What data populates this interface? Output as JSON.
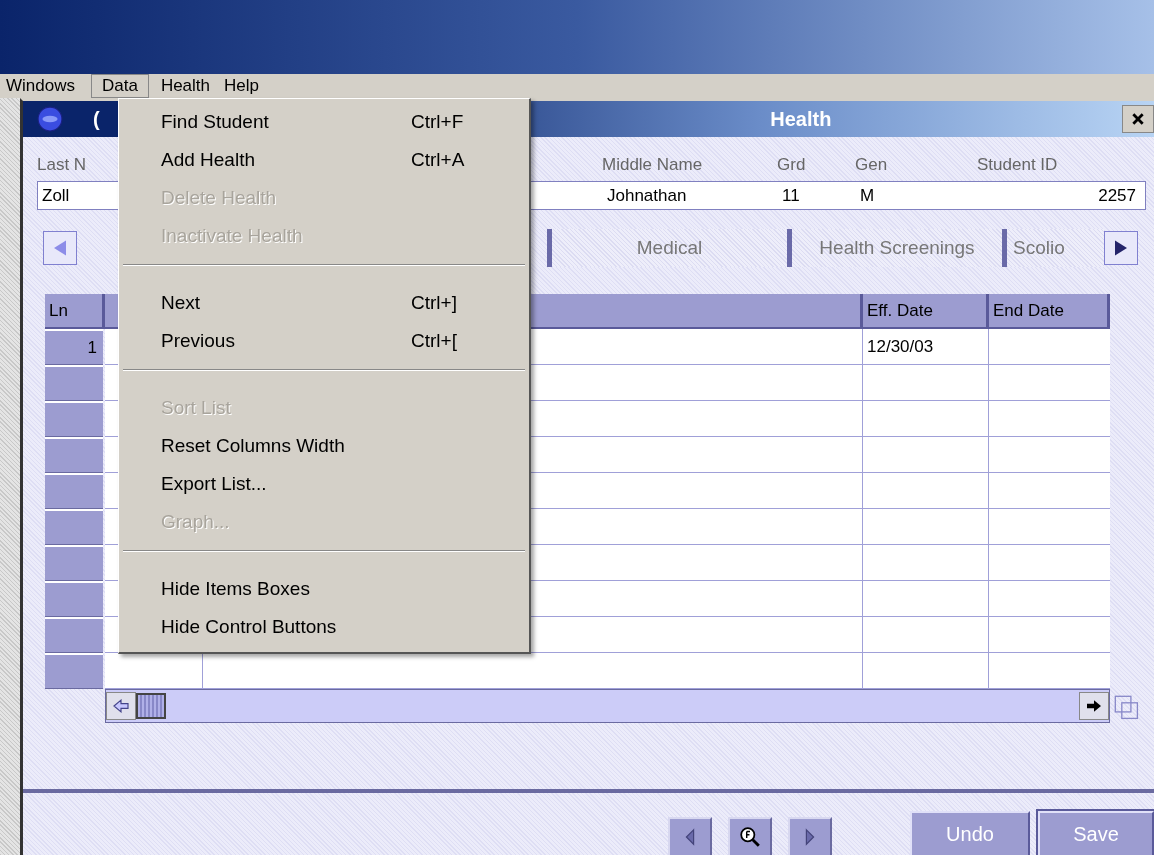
{
  "menu_bar": [
    {
      "label": "Windows",
      "selected": false
    },
    {
      "label": "Data",
      "selected": true
    },
    {
      "label": "Health",
      "selected": false
    },
    {
      "label": "Help",
      "selected": false
    }
  ],
  "menu": [
    {
      "kind": "item",
      "label": "Find Student",
      "shortcut": "Ctrl+F",
      "disabled": false
    },
    {
      "kind": "item",
      "label": "Add Health",
      "shortcut": "Ctrl+A",
      "disabled": false
    },
    {
      "kind": "item",
      "label": "Delete Health",
      "disabled": true
    },
    {
      "kind": "item",
      "label": "Inactivate Health",
      "disabled": true
    },
    {
      "kind": "separator"
    },
    {
      "kind": "item",
      "label": "Next",
      "shortcut": "Ctrl+]",
      "disabled": false
    },
    {
      "kind": "item",
      "label": "Previous",
      "shortcut": "Ctrl+[",
      "disabled": false
    },
    {
      "kind": "separator"
    },
    {
      "kind": "item",
      "label": "Sort List",
      "disabled": true
    },
    {
      "kind": "item",
      "label": "Reset Columns Width",
      "disabled": false
    },
    {
      "kind": "item",
      "label": "Export List...",
      "disabled": false
    },
    {
      "kind": "item",
      "label": "Graph...",
      "disabled": true
    },
    {
      "kind": "separator"
    },
    {
      "kind": "item",
      "label": "Hide Items Boxes",
      "disabled": false
    },
    {
      "kind": "item",
      "label": "Hide Control Buttons",
      "disabled": false
    }
  ],
  "window": {
    "title_prefix": "(",
    "title": "Health"
  },
  "student": {
    "last_name_label": "Last N",
    "last_name": "Zoll",
    "middle_name_label": "Middle Name",
    "middle_name": "Johnathan",
    "grade_label": "Grd",
    "grade": "11",
    "gender_label": "Gen",
    "gender": "M",
    "student_id_label": "Student ID",
    "student_id": "2257"
  },
  "tabs": [
    {
      "label": "Medical"
    },
    {
      "label": "Health Screenings"
    },
    {
      "label": "Scolio"
    }
  ],
  "table": {
    "columns": {
      "ln": "Ln",
      "eff_date": "Eff. Date",
      "end_date": "End Date"
    },
    "rows": [
      {
        "ln": "1",
        "eff_date": "12/30/03"
      },
      {},
      {},
      {},
      {},
      {},
      {},
      {},
      {},
      {}
    ]
  },
  "buttons": {
    "undo": "Undo",
    "save": "Save"
  }
}
